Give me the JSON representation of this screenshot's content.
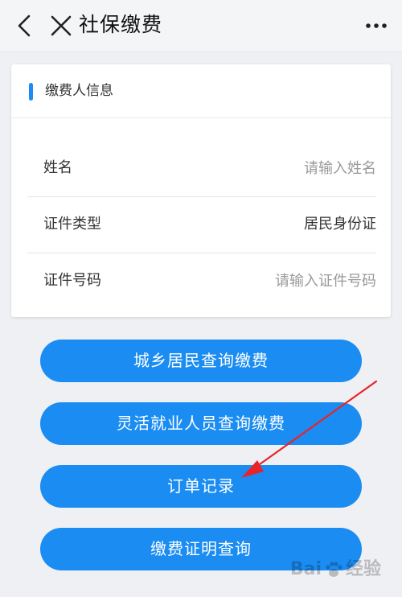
{
  "header": {
    "title": "社保缴费"
  },
  "payer_card": {
    "title": "缴费人信息",
    "rows": [
      {
        "label": "姓名",
        "placeholder": "请输入姓名",
        "value": ""
      },
      {
        "label": "证件类型",
        "value": "居民身份证"
      },
      {
        "label": "证件号码",
        "placeholder": "请输入证件号码",
        "value": ""
      }
    ]
  },
  "actions": {
    "urban_rural": "城乡居民查询缴费",
    "flexible_employment": "灵活就业人员查询缴费",
    "order_records": "订单记录",
    "payment_certificate": "缴费证明查询"
  },
  "watermark": {
    "text_left": "Bai",
    "text_right": "经验"
  },
  "colors": {
    "accent": "#1a8cf2",
    "annotation_arrow": "#e8242a"
  }
}
